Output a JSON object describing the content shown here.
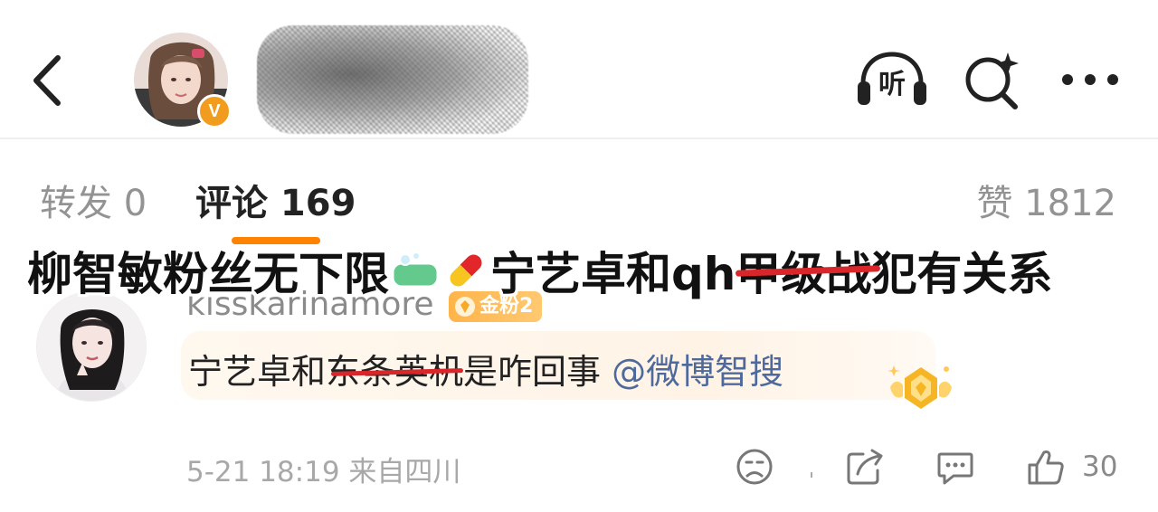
{
  "header": {
    "back_icon": "chevron-left-icon",
    "verified_badge": "V",
    "listen_label": "听",
    "search_icon": "search-sparkle-icon",
    "more_icon": "more-dots-icon"
  },
  "tabs": {
    "repost_label": "转发 0",
    "comment_label": "评论 169",
    "like_label": "赞 1812"
  },
  "caption": {
    "part1": "柳智敏粉丝无下限",
    "part2": "宁艺卓和qh",
    "struck": "甲级战",
    "part3": "犯有关系"
  },
  "comment": {
    "username": "kisskarinamore",
    "fan_badge": "金粉2",
    "text_before": "宁艺卓和",
    "text_struck": "东条英机",
    "text_after": "是咋回事",
    "mention": "@微博智搜",
    "timestamp": "5-21 18:19",
    "location": "来自四川",
    "like_count": "30"
  },
  "colors": {
    "accent": "#ff8200",
    "mention": "#4e6a9c",
    "strike": "#d8262a",
    "muted": "#939393"
  }
}
